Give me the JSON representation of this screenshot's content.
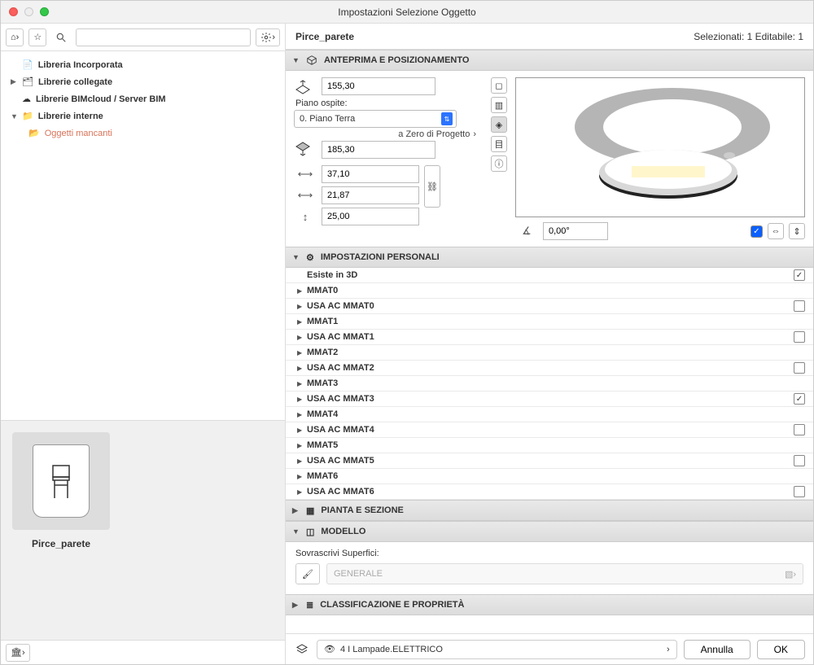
{
  "title": "Impostazioni Selezione Oggetto",
  "object_name": "Pirce_parete",
  "status": "Selezionati: 1 Editabile: 1",
  "library_tree": {
    "embedded": "Libreria Incorporata",
    "linked": "Librerie collegate",
    "bimcloud": "Librerie BIMcloud / Server BIM",
    "internal": "Librerie interne",
    "missing": "Oggetti mancanti"
  },
  "thumb_name": "Pirce_parete",
  "panels": {
    "preview": "ANTEPRIMA E POSIZIONAMENTO",
    "custom": "IMPOSTAZIONI PERSONALI",
    "plan": "PIANTA E SEZIONE",
    "model": "MODELLO",
    "class": "CLASSIFICAZIONE E PROPRIETÀ"
  },
  "positioning": {
    "top_height": "155,30",
    "host_label": "Piano ospite:",
    "host_value": "0. Piano Terra",
    "zero_link": "a Zero di Progetto",
    "base_height": "185,30",
    "dim_x": "37,10",
    "dim_y": "21,87",
    "dim_z": "25,00",
    "angle": "0,00°"
  },
  "settings_rows": [
    {
      "label": "Esiste in 3D",
      "checkbox": true,
      "checked": true,
      "arrow": false
    },
    {
      "label": "MMAT0",
      "checkbox": false,
      "arrow": true
    },
    {
      "label": "USA AC MMAT0",
      "checkbox": true,
      "checked": false,
      "arrow": true
    },
    {
      "label": "MMAT1",
      "checkbox": false,
      "arrow": true
    },
    {
      "label": "USA AC MMAT1",
      "checkbox": true,
      "checked": false,
      "arrow": true
    },
    {
      "label": "MMAT2",
      "checkbox": false,
      "arrow": true
    },
    {
      "label": "USA AC MMAT2",
      "checkbox": true,
      "checked": false,
      "arrow": true
    },
    {
      "label": "MMAT3",
      "checkbox": false,
      "arrow": true
    },
    {
      "label": "USA AC MMAT3",
      "checkbox": true,
      "checked": true,
      "arrow": true
    },
    {
      "label": "MMAT4",
      "checkbox": false,
      "arrow": true
    },
    {
      "label": "USA AC MMAT4",
      "checkbox": true,
      "checked": false,
      "arrow": true
    },
    {
      "label": "MMAT5",
      "checkbox": false,
      "arrow": true
    },
    {
      "label": "USA AC MMAT5",
      "checkbox": true,
      "checked": false,
      "arrow": true
    },
    {
      "label": "MMAT6",
      "checkbox": false,
      "arrow": true
    },
    {
      "label": "USA AC MMAT6",
      "checkbox": true,
      "checked": false,
      "arrow": true
    }
  ],
  "model_panel": {
    "override_label": "Sovrascrivi Superfici:",
    "general": "GENERALE"
  },
  "layer_field": "4 I Lampade.ELETTRICO",
  "buttons": {
    "cancel": "Annulla",
    "ok": "OK"
  }
}
